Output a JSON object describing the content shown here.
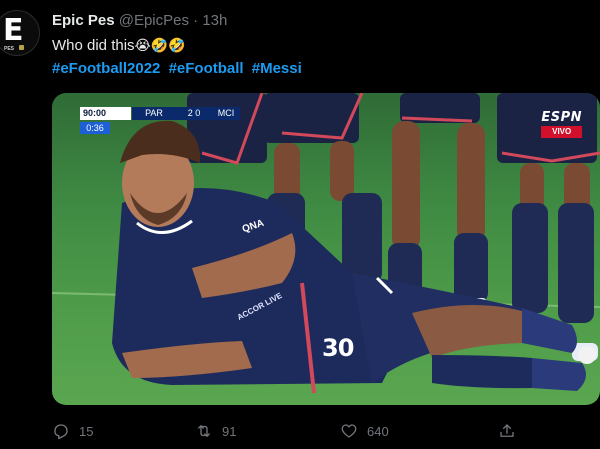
{
  "tweet": {
    "avatar": {
      "logo_letter": "E",
      "logo_sub": "PES"
    },
    "display_name": "Epic Pes",
    "handle": "@EpicPes",
    "separator": "·",
    "timestamp": "13h",
    "text": "Who did this",
    "emojis": "😭🤣🤣",
    "hashtags": [
      "#eFootball2022",
      "#eFootball",
      "#Messi"
    ]
  },
  "media": {
    "scoreboard": {
      "clock": "90:00",
      "home": "PAR",
      "score": "2  0",
      "away": "MCI",
      "extra_time": "0:36"
    },
    "broadcaster": {
      "logo": "ESPN",
      "tag": "VIVO"
    },
    "jersey_number": "30",
    "sponsor_chest": "ACCOR LIVE",
    "sponsor_top": "QNA"
  },
  "actions": {
    "reply_count": "15",
    "retweet_count": "91",
    "like_count": "640",
    "icons": [
      "reply-icon",
      "retweet-icon",
      "like-icon",
      "share-icon"
    ],
    "icon_color": "#71767b"
  },
  "colors": {
    "hashtag": "#1d9bf0",
    "background": "#000000",
    "text": "#e7e9ea",
    "muted": "#71767b"
  }
}
